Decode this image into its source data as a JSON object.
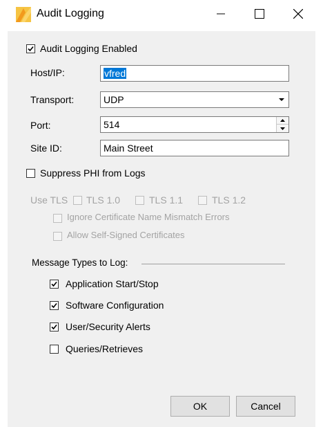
{
  "window": {
    "title": "Audit Logging"
  },
  "audit_enabled": {
    "label": "Audit Logging Enabled",
    "checked": true
  },
  "fields": {
    "host": {
      "label": "Host/IP:",
      "value": "vfred"
    },
    "transport": {
      "label": "Transport:",
      "value": "UDP"
    },
    "port": {
      "label": "Port:",
      "value": "514"
    },
    "site": {
      "label": "Site ID:",
      "value": "Main Street"
    }
  },
  "suppress_phi": {
    "label": "Suppress PHI from Logs",
    "checked": false
  },
  "tls": {
    "use_label": "Use TLS",
    "v10": "TLS 1.0",
    "v11": "TLS 1.1",
    "v12": "TLS 1.2",
    "ignore_mismatch": "Ignore Certificate Name Mismatch Errors",
    "allow_self_signed": "Allow Self-Signed Certificates"
  },
  "message_types": {
    "group_label": "Message Types to Log:",
    "items": [
      {
        "label": "Application Start/Stop",
        "checked": true
      },
      {
        "label": "Software Configuration",
        "checked": true
      },
      {
        "label": "User/Security Alerts",
        "checked": true
      },
      {
        "label": "Queries/Retrieves",
        "checked": false
      }
    ]
  },
  "buttons": {
    "ok": "OK",
    "cancel": "Cancel"
  },
  "colors": {
    "selection": "#0078d7",
    "dialog_bg": "#f0f0f0",
    "disabled_text": "#a3a3a3"
  },
  "icons": [
    "app-logo-icon",
    "minimize-icon",
    "maximize-icon",
    "close-icon",
    "checkmark-icon",
    "dropdown-arrow-icon",
    "spin-up-icon",
    "spin-down-icon"
  ]
}
